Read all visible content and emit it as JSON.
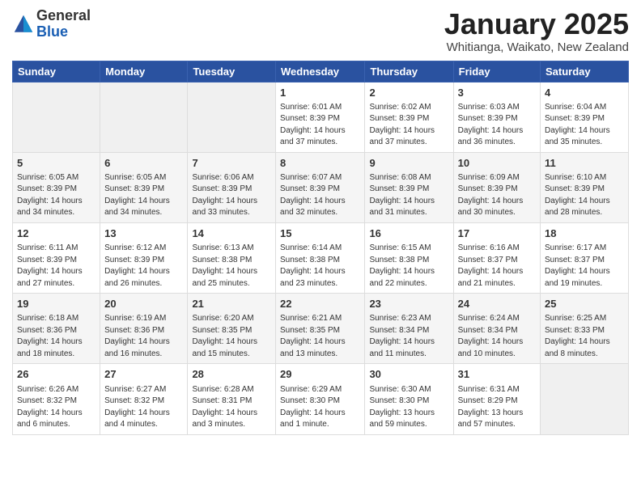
{
  "header": {
    "logo_general": "General",
    "logo_blue": "Blue",
    "month_title": "January 2025",
    "subtitle": "Whitianga, Waikato, New Zealand"
  },
  "weekdays": [
    "Sunday",
    "Monday",
    "Tuesday",
    "Wednesday",
    "Thursday",
    "Friday",
    "Saturday"
  ],
  "weeks": [
    [
      {
        "day": "",
        "info": ""
      },
      {
        "day": "",
        "info": ""
      },
      {
        "day": "",
        "info": ""
      },
      {
        "day": "1",
        "info": "Sunrise: 6:01 AM\nSunset: 8:39 PM\nDaylight: 14 hours\nand 37 minutes."
      },
      {
        "day": "2",
        "info": "Sunrise: 6:02 AM\nSunset: 8:39 PM\nDaylight: 14 hours\nand 37 minutes."
      },
      {
        "day": "3",
        "info": "Sunrise: 6:03 AM\nSunset: 8:39 PM\nDaylight: 14 hours\nand 36 minutes."
      },
      {
        "day": "4",
        "info": "Sunrise: 6:04 AM\nSunset: 8:39 PM\nDaylight: 14 hours\nand 35 minutes."
      }
    ],
    [
      {
        "day": "5",
        "info": "Sunrise: 6:05 AM\nSunset: 8:39 PM\nDaylight: 14 hours\nand 34 minutes."
      },
      {
        "day": "6",
        "info": "Sunrise: 6:05 AM\nSunset: 8:39 PM\nDaylight: 14 hours\nand 34 minutes."
      },
      {
        "day": "7",
        "info": "Sunrise: 6:06 AM\nSunset: 8:39 PM\nDaylight: 14 hours\nand 33 minutes."
      },
      {
        "day": "8",
        "info": "Sunrise: 6:07 AM\nSunset: 8:39 PM\nDaylight: 14 hours\nand 32 minutes."
      },
      {
        "day": "9",
        "info": "Sunrise: 6:08 AM\nSunset: 8:39 PM\nDaylight: 14 hours\nand 31 minutes."
      },
      {
        "day": "10",
        "info": "Sunrise: 6:09 AM\nSunset: 8:39 PM\nDaylight: 14 hours\nand 30 minutes."
      },
      {
        "day": "11",
        "info": "Sunrise: 6:10 AM\nSunset: 8:39 PM\nDaylight: 14 hours\nand 28 minutes."
      }
    ],
    [
      {
        "day": "12",
        "info": "Sunrise: 6:11 AM\nSunset: 8:39 PM\nDaylight: 14 hours\nand 27 minutes."
      },
      {
        "day": "13",
        "info": "Sunrise: 6:12 AM\nSunset: 8:39 PM\nDaylight: 14 hours\nand 26 minutes."
      },
      {
        "day": "14",
        "info": "Sunrise: 6:13 AM\nSunset: 8:38 PM\nDaylight: 14 hours\nand 25 minutes."
      },
      {
        "day": "15",
        "info": "Sunrise: 6:14 AM\nSunset: 8:38 PM\nDaylight: 14 hours\nand 23 minutes."
      },
      {
        "day": "16",
        "info": "Sunrise: 6:15 AM\nSunset: 8:38 PM\nDaylight: 14 hours\nand 22 minutes."
      },
      {
        "day": "17",
        "info": "Sunrise: 6:16 AM\nSunset: 8:37 PM\nDaylight: 14 hours\nand 21 minutes."
      },
      {
        "day": "18",
        "info": "Sunrise: 6:17 AM\nSunset: 8:37 PM\nDaylight: 14 hours\nand 19 minutes."
      }
    ],
    [
      {
        "day": "19",
        "info": "Sunrise: 6:18 AM\nSunset: 8:36 PM\nDaylight: 14 hours\nand 18 minutes."
      },
      {
        "day": "20",
        "info": "Sunrise: 6:19 AM\nSunset: 8:36 PM\nDaylight: 14 hours\nand 16 minutes."
      },
      {
        "day": "21",
        "info": "Sunrise: 6:20 AM\nSunset: 8:35 PM\nDaylight: 14 hours\nand 15 minutes."
      },
      {
        "day": "22",
        "info": "Sunrise: 6:21 AM\nSunset: 8:35 PM\nDaylight: 14 hours\nand 13 minutes."
      },
      {
        "day": "23",
        "info": "Sunrise: 6:23 AM\nSunset: 8:34 PM\nDaylight: 14 hours\nand 11 minutes."
      },
      {
        "day": "24",
        "info": "Sunrise: 6:24 AM\nSunset: 8:34 PM\nDaylight: 14 hours\nand 10 minutes."
      },
      {
        "day": "25",
        "info": "Sunrise: 6:25 AM\nSunset: 8:33 PM\nDaylight: 14 hours\nand 8 minutes."
      }
    ],
    [
      {
        "day": "26",
        "info": "Sunrise: 6:26 AM\nSunset: 8:32 PM\nDaylight: 14 hours\nand 6 minutes."
      },
      {
        "day": "27",
        "info": "Sunrise: 6:27 AM\nSunset: 8:32 PM\nDaylight: 14 hours\nand 4 minutes."
      },
      {
        "day": "28",
        "info": "Sunrise: 6:28 AM\nSunset: 8:31 PM\nDaylight: 14 hours\nand 3 minutes."
      },
      {
        "day": "29",
        "info": "Sunrise: 6:29 AM\nSunset: 8:30 PM\nDaylight: 14 hours\nand 1 minute."
      },
      {
        "day": "30",
        "info": "Sunrise: 6:30 AM\nSunset: 8:30 PM\nDaylight: 13 hours\nand 59 minutes."
      },
      {
        "day": "31",
        "info": "Sunrise: 6:31 AM\nSunset: 8:29 PM\nDaylight: 13 hours\nand 57 minutes."
      },
      {
        "day": "",
        "info": ""
      }
    ]
  ]
}
